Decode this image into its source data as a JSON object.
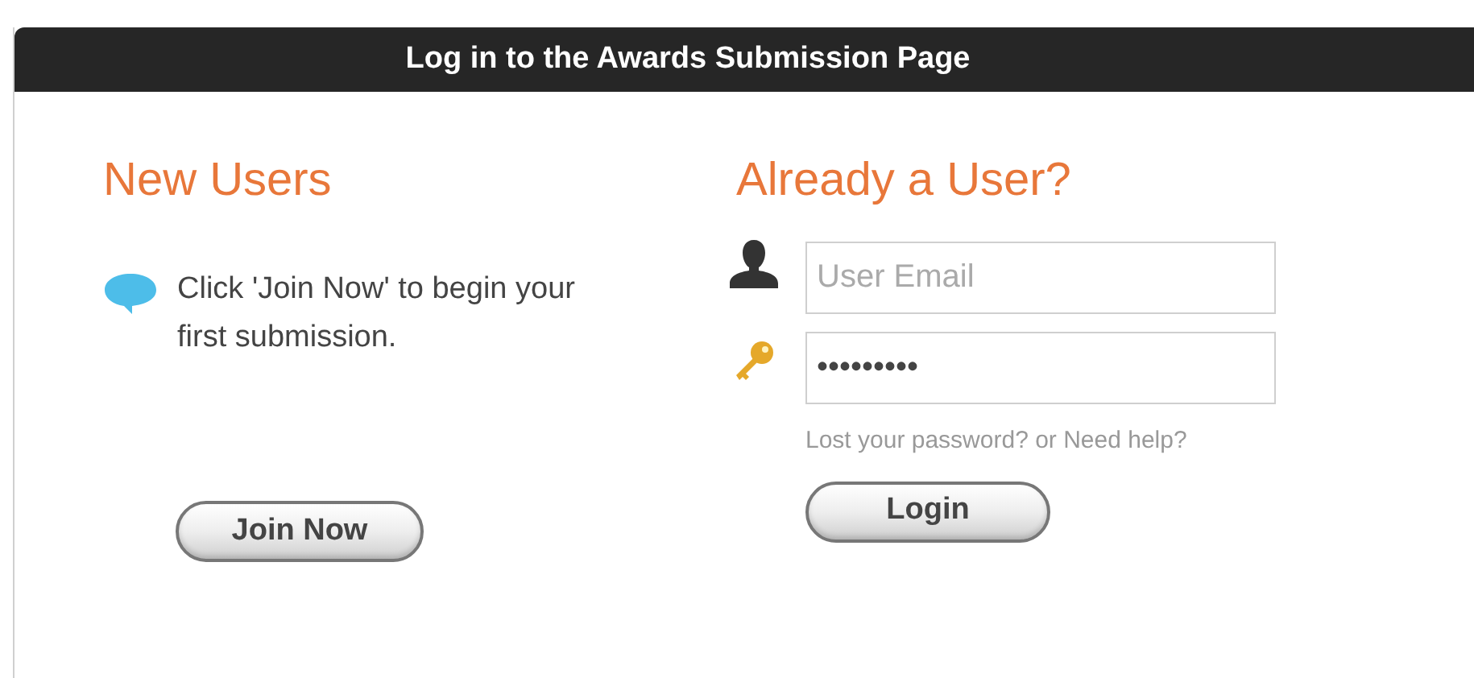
{
  "header": {
    "title": "Log in to the Awards Submission Page"
  },
  "new_users": {
    "heading": "New Users",
    "message": "Click 'Join Now' to begin your first submission.",
    "button": "Join Now"
  },
  "existing_users": {
    "heading": "Already a User?",
    "email": {
      "placeholder": "User Email"
    },
    "password": {
      "value": "•••••••••"
    },
    "help_link": "Lost your password? or Need help?",
    "button": "Login"
  }
}
